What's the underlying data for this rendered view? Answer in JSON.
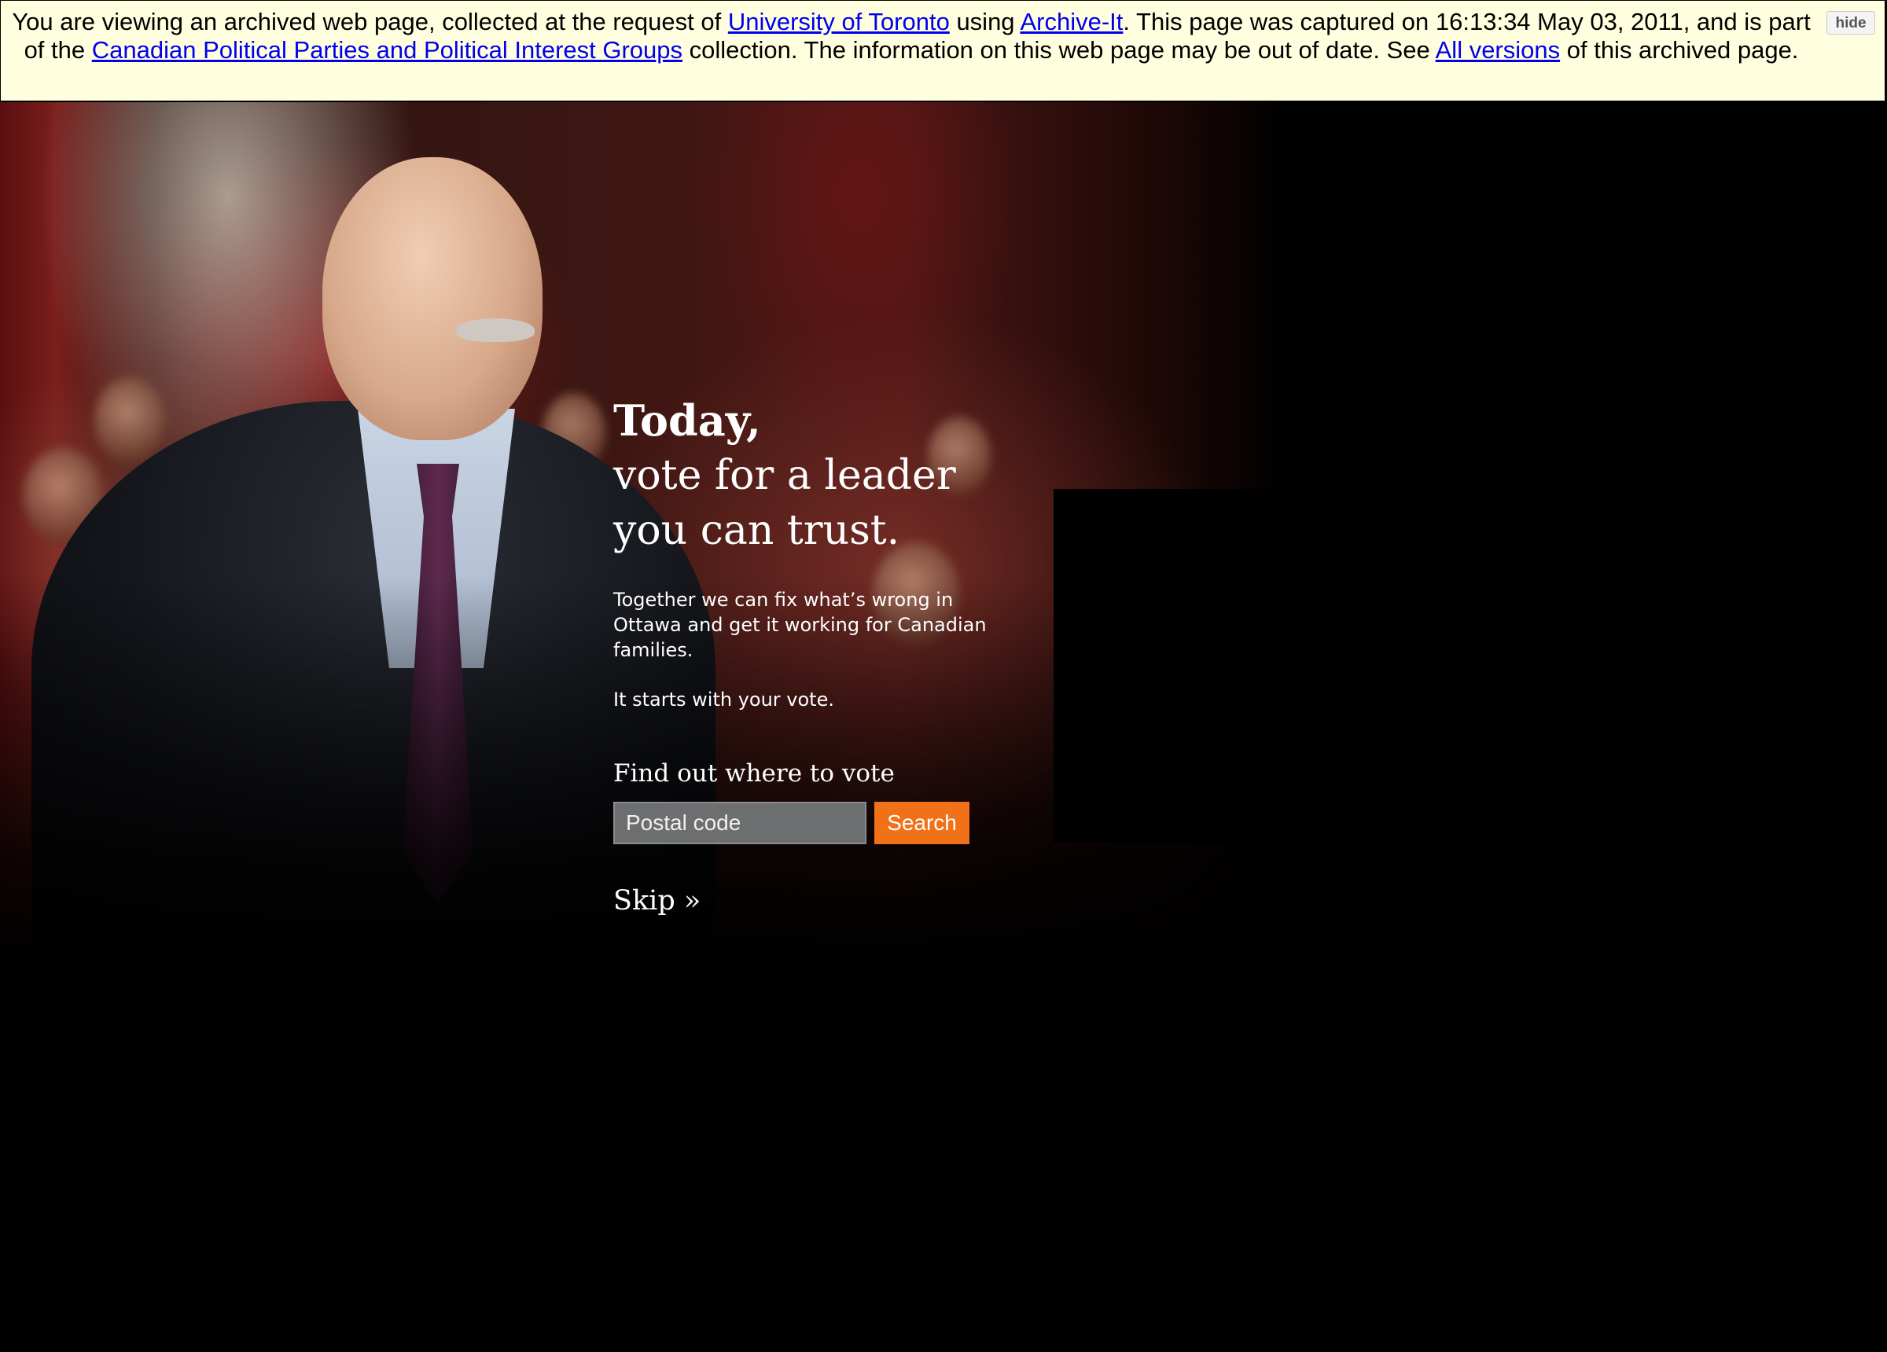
{
  "archive_banner": {
    "text_1": "You are viewing an archived web page, collected at the request of ",
    "link_org": "University of Toronto",
    "text_2": " using ",
    "link_service": "Archive-It",
    "text_3": ". This page was captured on 16:13:34 May 03, 2011, and is part of the ",
    "link_collection": "Canadian Political Parties and Political Interest Groups",
    "text_4": " collection. The information on this web page may be out of date. See ",
    "link_versions": "All versions",
    "text_5": " of this archived page.",
    "hide_label": "hide",
    "link_color": "#0000ee",
    "background": "#ffffe0"
  },
  "hero": {
    "headline_strong": "Today,",
    "headline_line_1": "vote for a leader",
    "headline_line_2": "you can trust.",
    "body_text": "Together we can fix what’s wrong in Ottawa and get it working for Canadian families.",
    "body_text_2": "It starts with your vote.",
    "find_label": "Find out where to vote",
    "postal_placeholder": "Postal code",
    "search_label": "Search",
    "skip_label": "Skip »",
    "accent_color": "#f07117"
  }
}
